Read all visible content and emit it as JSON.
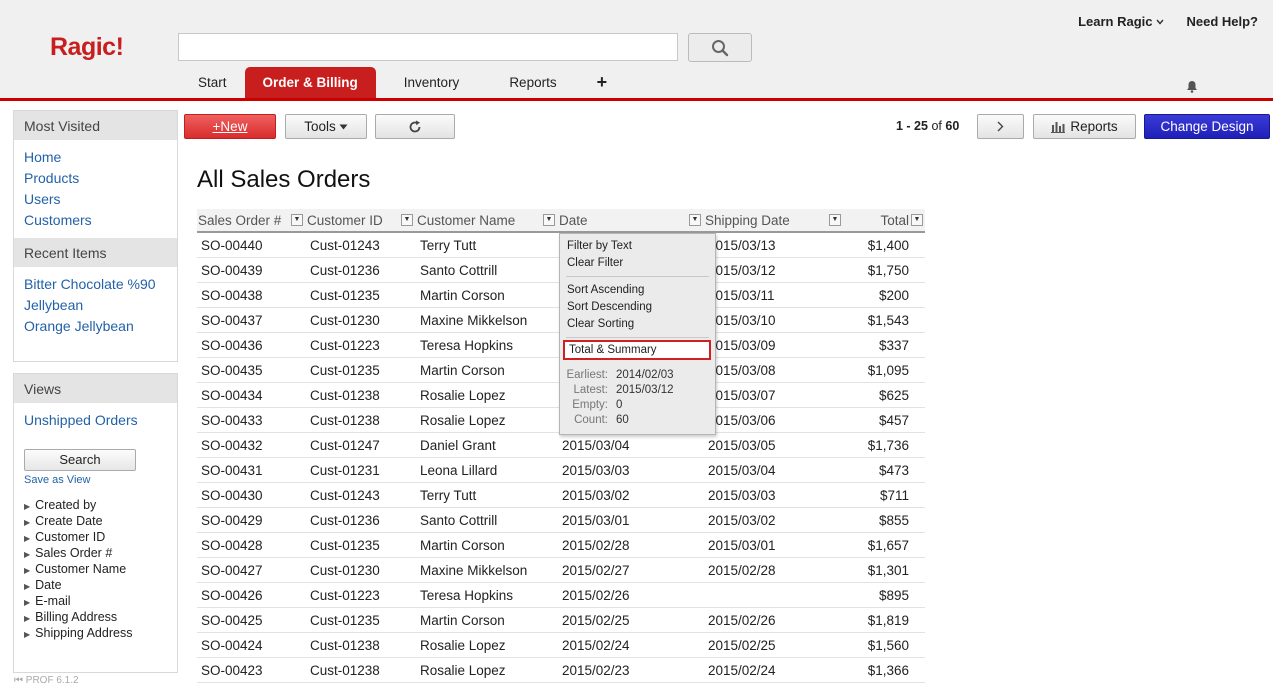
{
  "header": {
    "logo": "Ragic!",
    "search_placeholder": "",
    "learn": "Learn Ragic",
    "help": "Need Help?",
    "tabs": [
      "Start",
      "Order & Billing",
      "Inventory",
      "Reports",
      "+"
    ]
  },
  "sidebar": {
    "most_visited_title": "Most Visited",
    "most_visited": [
      "Home",
      "Products",
      "Users",
      "Customers"
    ],
    "recent_title": "Recent Items",
    "recent": [
      "Bitter Chocolate %90",
      "Jellybean",
      "Orange Jellybean"
    ],
    "views_title": "Views",
    "views": [
      "Unshipped Orders"
    ],
    "search_button": "Search",
    "save_as_view": "Save as View",
    "fields": [
      "Created by",
      "Create Date",
      "Customer ID",
      "Sales Order #",
      "Customer Name",
      "Date",
      "E-mail",
      "Billing Address",
      "Shipping Address"
    ],
    "version": "PROF 6.1.2"
  },
  "toolbar": {
    "new_label": "+New",
    "tools_label": "Tools",
    "reports_label": "Reports",
    "design_label": "Change Design",
    "pager_range": "1 - 25",
    "pager_of": "of",
    "pager_total": "60"
  },
  "page_title": "All Sales Orders",
  "columns": [
    "Sales Order #",
    "Customer ID",
    "Customer Name",
    "Date",
    "Shipping Date",
    "Total"
  ],
  "rows": [
    [
      "SO-00440",
      "Cust-01243",
      "Terry Tutt",
      "",
      "2015/03/13",
      "$1,400"
    ],
    [
      "SO-00439",
      "Cust-01236",
      "Santo Cottrill",
      "",
      "2015/03/12",
      "$1,750"
    ],
    [
      "SO-00438",
      "Cust-01235",
      "Martin Corson",
      "",
      "2015/03/11",
      "$200"
    ],
    [
      "SO-00437",
      "Cust-01230",
      "Maxine Mikkelson",
      "",
      "2015/03/10",
      "$1,543"
    ],
    [
      "SO-00436",
      "Cust-01223",
      "Teresa Hopkins",
      "",
      "2015/03/09",
      "$337"
    ],
    [
      "SO-00435",
      "Cust-01235",
      "Martin Corson",
      "",
      "2015/03/08",
      "$1,095"
    ],
    [
      "SO-00434",
      "Cust-01238",
      "Rosalie Lopez",
      "",
      "2015/03/07",
      "$625"
    ],
    [
      "SO-00433",
      "Cust-01238",
      "Rosalie Lopez",
      "",
      "2015/03/06",
      "$457"
    ],
    [
      "SO-00432",
      "Cust-01247",
      "Daniel Grant",
      "2015/03/04",
      "2015/03/05",
      "$1,736"
    ],
    [
      "SO-00431",
      "Cust-01231",
      "Leona Lillard",
      "2015/03/03",
      "2015/03/04",
      "$473"
    ],
    [
      "SO-00430",
      "Cust-01243",
      "Terry Tutt",
      "2015/03/02",
      "2015/03/03",
      "$711"
    ],
    [
      "SO-00429",
      "Cust-01236",
      "Santo Cottrill",
      "2015/03/01",
      "2015/03/02",
      "$855"
    ],
    [
      "SO-00428",
      "Cust-01235",
      "Martin Corson",
      "2015/02/28",
      "2015/03/01",
      "$1,657"
    ],
    [
      "SO-00427",
      "Cust-01230",
      "Maxine Mikkelson",
      "2015/02/27",
      "2015/02/28",
      "$1,301"
    ],
    [
      "SO-00426",
      "Cust-01223",
      "Teresa Hopkins",
      "2015/02/26",
      "",
      "$895"
    ],
    [
      "SO-00425",
      "Cust-01235",
      "Martin Corson",
      "2015/02/25",
      "2015/02/26",
      "$1,819"
    ],
    [
      "SO-00424",
      "Cust-01238",
      "Rosalie Lopez",
      "2015/02/24",
      "2015/02/25",
      "$1,560"
    ],
    [
      "SO-00423",
      "Cust-01238",
      "Rosalie Lopez",
      "2015/02/23",
      "2015/02/24",
      "$1,366"
    ]
  ],
  "menu": {
    "filter_text": "Filter by Text",
    "clear_filter": "Clear Filter",
    "sort_asc": "Sort Ascending",
    "sort_desc": "Sort Descending",
    "clear_sort": "Clear Sorting",
    "summary": "Total & Summary",
    "stats": [
      {
        "label": "Earliest:",
        "value": "2014/02/03"
      },
      {
        "label": "Latest:",
        "value": "2015/03/12"
      },
      {
        "label": "Empty:",
        "value": "0"
      },
      {
        "label": "Count:",
        "value": "60"
      }
    ]
  },
  "colors": {
    "brand_red": "#c81e1e",
    "link_blue": "#2461a8",
    "design_blue": "#2a2ac8"
  }
}
